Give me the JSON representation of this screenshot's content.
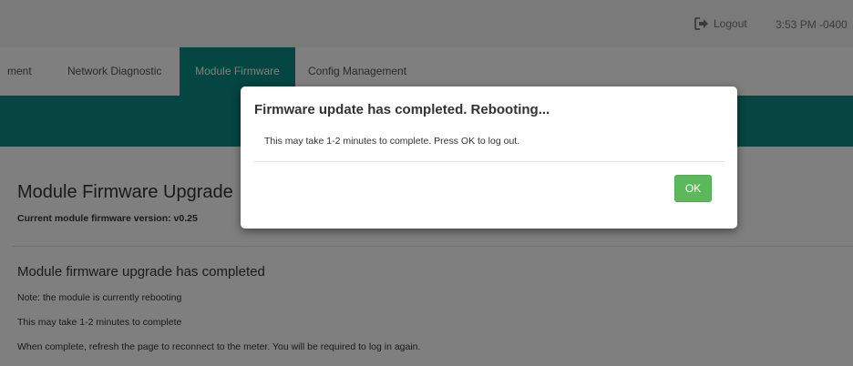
{
  "header": {
    "logout_label": "Logout",
    "time": "3:53 PM -0400"
  },
  "tabs": [
    {
      "label": "ment"
    },
    {
      "label": "Network Diagnostic"
    },
    {
      "label": "Module Firmware",
      "active": true
    },
    {
      "label": "Config Management"
    }
  ],
  "page": {
    "title": "Module Firmware Upgrade",
    "version_text": "Current module firmware version: v0.25",
    "status_heading": "Module firmware upgrade has completed",
    "notes": [
      "Note: the module is currently rebooting",
      "This may take 1-2 minutes to complete",
      "When complete, refresh the page to reconnect to the meter. You will be required to log in again."
    ]
  },
  "modal": {
    "title": "Firmware update has completed. Rebooting...",
    "body": "This may take 1-2 minutes to complete. Press OK to log out.",
    "ok_label": "OK"
  },
  "colors": {
    "accent": "#0a8a85",
    "ok_button": "#5cb85c"
  },
  "icons": {
    "logout": "sign-out-icon"
  }
}
